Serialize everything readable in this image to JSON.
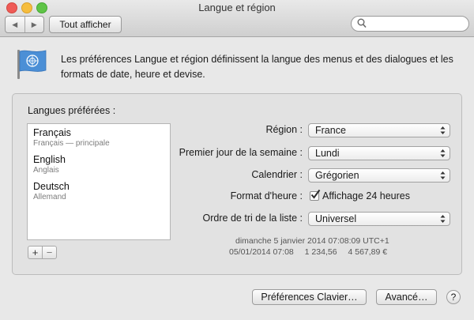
{
  "window": {
    "title": "Langue et région"
  },
  "toolbar": {
    "back": "◀",
    "forward": "▶",
    "show_all": "Tout afficher",
    "search_placeholder": ""
  },
  "description": "Les préférences Langue et région définissent la langue des menus et des dialogues et les formats de date, heure et devise.",
  "languages": {
    "label": "Langues préférées :",
    "items": [
      {
        "name": "Français",
        "sub": "Français — principale"
      },
      {
        "name": "English",
        "sub": "Anglais"
      },
      {
        "name": "Deutsch",
        "sub": "Allemand"
      }
    ],
    "add": "+",
    "remove": "−"
  },
  "settings": {
    "region_label": "Région :",
    "region_value": "France",
    "first_day_label": "Premier jour de la semaine :",
    "first_day_value": "Lundi",
    "calendar_label": "Calendrier :",
    "calendar_value": "Grégorien",
    "time_format_label": "Format d'heure :",
    "time_format_checkbox": "Affichage 24 heures",
    "time_format_checked": true,
    "sort_label": "Ordre de tri de la liste :",
    "sort_value": "Universel"
  },
  "samples": {
    "line1": "dimanche 5 janvier 2014 07:08:09 UTC+1",
    "date_short": "05/01/2014 07:08",
    "number": "1 234,56",
    "currency": "4 567,89 €"
  },
  "buttons": {
    "keyboard_prefs": "Préférences Clavier…",
    "advanced": "Avancé…",
    "help": "?"
  },
  "colors": {
    "accent": "#2c5fb0",
    "window_bg": "#e8e8e8"
  }
}
